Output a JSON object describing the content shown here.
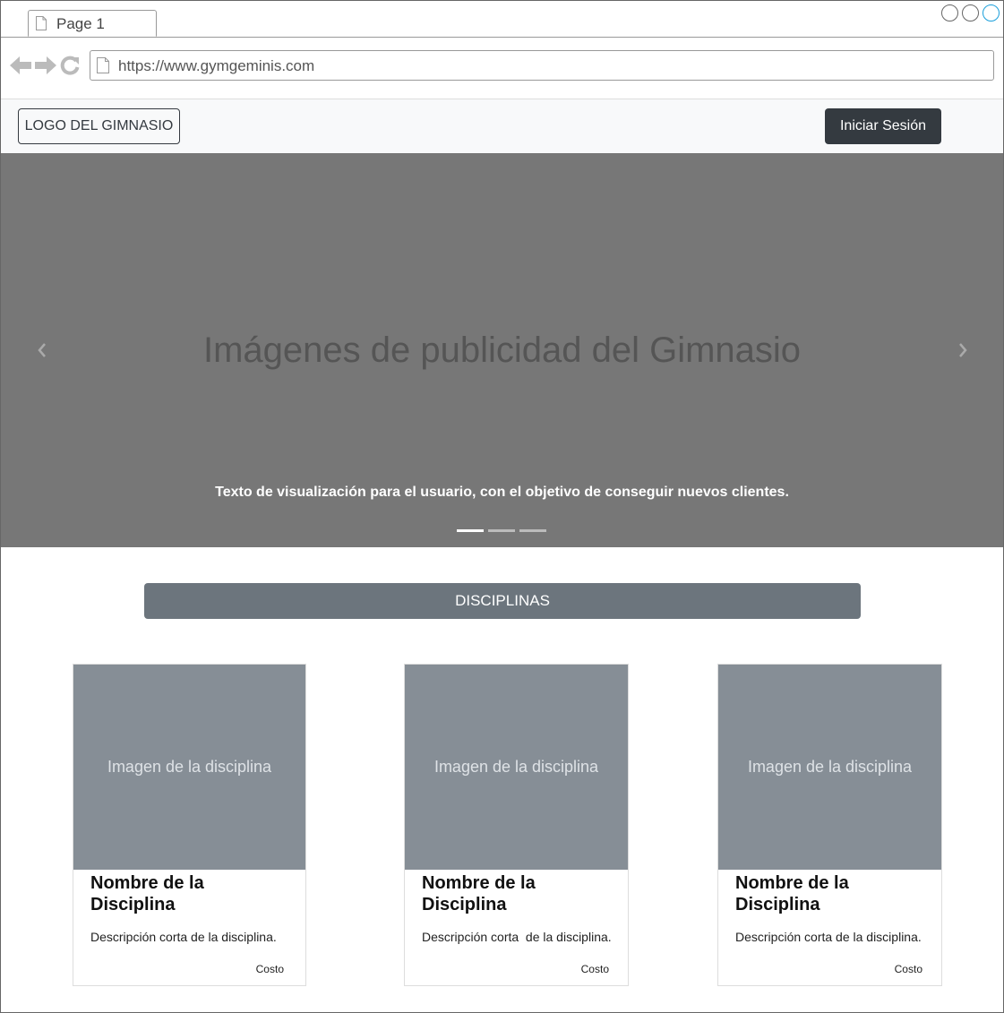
{
  "browser": {
    "tab_label": "Page 1",
    "url": "https://www.gymgeminis.com"
  },
  "navbar": {
    "logo_label": "LOGO DEL GIMNASIO",
    "login_label": "Iniciar Sesión"
  },
  "carousel": {
    "headline": "Imágenes de publicidad del Gimnasio",
    "caption": "Texto de visualización para el usuario, con el objetivo de conseguir nuevos clientes.",
    "slide_count": 3,
    "active_slide": 1
  },
  "disciplinas": {
    "button_label": "DISCIPLINAS",
    "cards": [
      {
        "image_label": "Imagen de la disciplina",
        "title": "Nombre de la Disciplina",
        "description": "Descripción corta de la disciplina.",
        "cost_label": "Costo"
      },
      {
        "image_label": "Imagen de la disciplina",
        "title": "Nombre de la Disciplina",
        "description": "Descripción corta  de la disciplina.",
        "cost_label": "Costo"
      },
      {
        "image_label": "Imagen de la disciplina",
        "title": "Nombre de la Disciplina",
        "description": "Descripción corta de la disciplina.",
        "cost_label": "Costo"
      }
    ]
  },
  "colors": {
    "navbar_bg": "#f8f9fa",
    "dark_button": "#343a40",
    "carousel_bg": "#777777",
    "secondary_button": "#6c757d",
    "card_image_bg": "#868e96",
    "window_active": "#1a9fdb"
  }
}
